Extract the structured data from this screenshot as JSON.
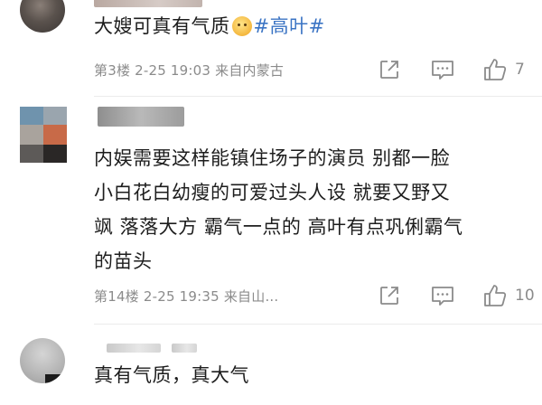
{
  "comments": [
    {
      "text": "大嫂可真有气质",
      "hashtag": "#高叶#",
      "meta": "第3楼  2-25 19:03  来自内蒙古",
      "likes": "7",
      "icons": [
        "avatar",
        "share-icon",
        "comment-icon",
        "like-icon"
      ]
    },
    {
      "text": "内娱需要这样能镇住场子的演员 别都一脸小白花白幼瘦的可爱过头人设 就要又野又飒 落落大方 霸气一点的 高叶有点巩俐霸气的苗头",
      "lines": [
        "内娱需要这样能镇住场子的演员 别都一脸",
        "小白花白幼瘦的可爱过头人设 就要又野又",
        "飒 落落大方 霸气一点的 高叶有点巩俐霸气",
        "的苗头"
      ],
      "meta": "第14楼  2-25 19:35  来自山...",
      "likes": "10"
    },
    {
      "text": "真有气质，真大气"
    }
  ],
  "colors": {
    "text": "#1d1d1d",
    "meta": "#8b8b8b",
    "hashtag": "#3b74c4",
    "background": "#ffffff"
  }
}
